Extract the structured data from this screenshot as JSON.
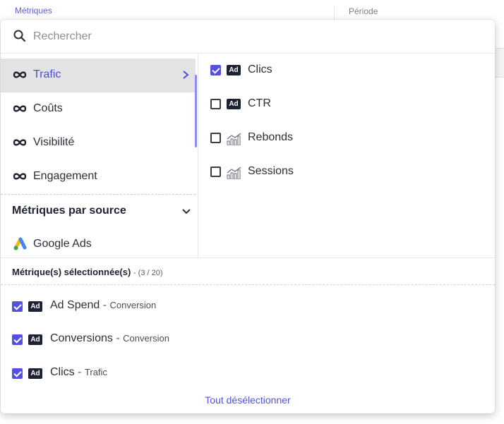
{
  "background": {
    "metrics_label": "Métriques",
    "period_label": "Période"
  },
  "search": {
    "placeholder": "Rechercher",
    "value": ""
  },
  "categories": [
    {
      "label": "Trafic",
      "active": true,
      "icon": "infinity-icon"
    },
    {
      "label": "Coûts",
      "active": false,
      "icon": "infinity-icon"
    },
    {
      "label": "Visibilité",
      "active": false,
      "icon": "infinity-icon"
    },
    {
      "label": "Engagement",
      "active": false,
      "icon": "infinity-icon"
    }
  ],
  "sources": {
    "heading": "Métriques par source",
    "items": [
      {
        "label": "Google Ads",
        "icon": "google-ads-icon"
      }
    ]
  },
  "metrics": [
    {
      "label": "Clics",
      "checked": true,
      "icon": "ad-badge-icon",
      "badge": "Ad"
    },
    {
      "label": "CTR",
      "checked": false,
      "icon": "ad-badge-icon",
      "badge": "Ad"
    },
    {
      "label": "Rebonds",
      "checked": false,
      "icon": "bar-chart-icon"
    },
    {
      "label": "Sessions",
      "checked": false,
      "icon": "bar-chart-icon"
    }
  ],
  "selected": {
    "heading": "Métrique(s) sélectionnée(s)",
    "count": "- (3 / 20)",
    "separator": "-",
    "items": [
      {
        "name": "Ad Spend",
        "category": "Conversion",
        "badge": "Ad"
      },
      {
        "name": "Conversions",
        "category": "Conversion",
        "badge": "Ad"
      },
      {
        "name": "Clics",
        "category": "Trafic",
        "badge": "Ad"
      }
    ],
    "deselect_label": "Tout désélectionner"
  },
  "colors": {
    "accent": "#5451e0",
    "active_bg": "#e3e3e5",
    "badge_bg": "#1d2233"
  }
}
